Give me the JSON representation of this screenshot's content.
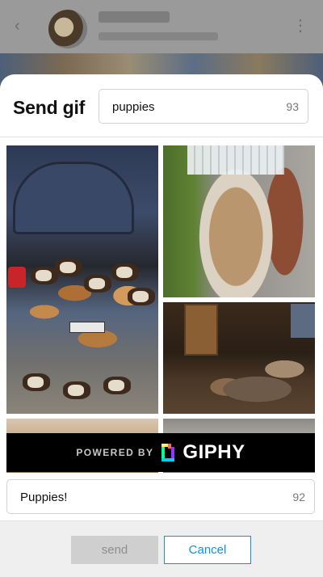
{
  "modal": {
    "title": "Send gif",
    "search": {
      "value": "puppies",
      "remaining": "93"
    },
    "results": [
      {
        "name": "gif-result-1"
      },
      {
        "name": "gif-result-2"
      },
      {
        "name": "gif-result-3"
      },
      {
        "name": "gif-result-4"
      },
      {
        "name": "gif-result-5"
      }
    ],
    "attribution": {
      "powered_by": "POWERED BY",
      "brand": "GIPHY"
    },
    "caption": {
      "value": "Puppies!",
      "remaining": "92"
    },
    "actions": {
      "send_label": "send",
      "cancel_label": "Cancel"
    }
  },
  "colors": {
    "accent": "#1a8fd6",
    "disabled_button": "#cfcfcf",
    "giphy_bar": "#000000"
  },
  "icons": [
    "chevron-left-icon",
    "more-icon",
    "giphy-logo-icon"
  ]
}
